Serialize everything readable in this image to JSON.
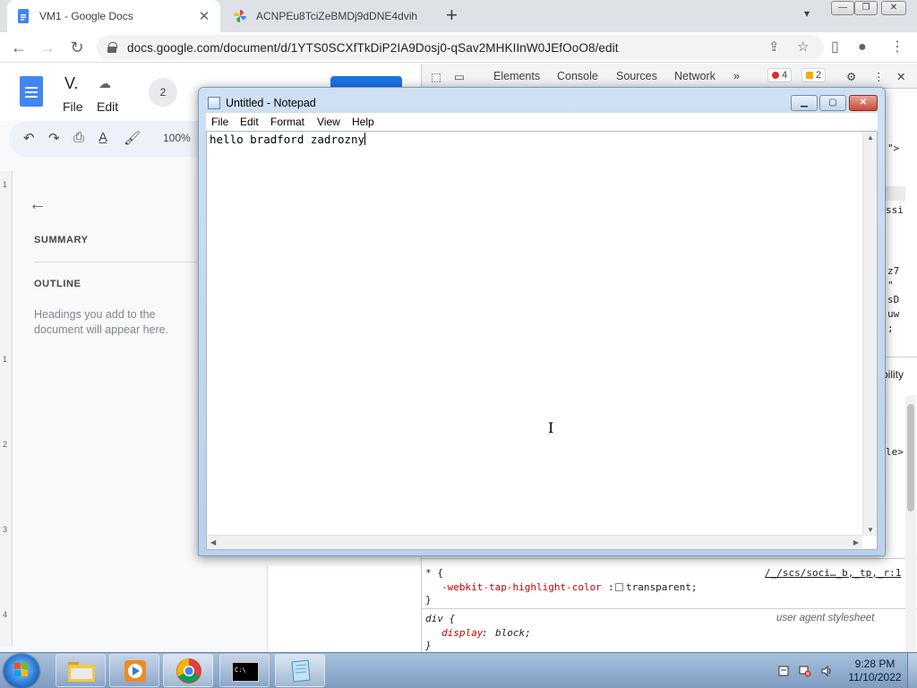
{
  "browser": {
    "tabs": [
      {
        "title": "VM1 - Google Docs",
        "close": "✕"
      },
      {
        "title": "ACNPEu8TciZeBMDj9dDNE4dvih"
      }
    ],
    "new_tab": "+",
    "url": "docs.google.com/document/d/1YTS0SCXfTkDiP2IA9Dosj0-qSav2MHKIInW0JEfOoO8/edit"
  },
  "docs": {
    "title": "V.",
    "menu": [
      "File",
      "Edit"
    ],
    "collaborators": "2",
    "zoom": "100%",
    "outline": {
      "summary": "SUMMARY",
      "outline": "OUTLINE",
      "hint": "Headings you add to the document will appear here."
    },
    "ruler": [
      "1",
      "1",
      "2",
      "3",
      "4"
    ]
  },
  "devtools": {
    "tabs": [
      "Elements",
      "Console",
      "Sources",
      "Network"
    ],
    "more": "»",
    "errors": "4",
    "warnings": "2",
    "side_fragments": [
      "\">",
      "ssi",
      "z7",
      "\"",
      "sD",
      "uw",
      ";",
      "bility",
      "le>"
    ],
    "styles": [
      {
        "selector": "* {",
        "source": "/_/scs/soci…_b,_tp,_r:1",
        "prop": "-webkit-tap-highlight-color",
        "value": "transparent;",
        "close": "}"
      },
      {
        "selector": "div {",
        "source": "user agent stylesheet",
        "prop": "display",
        "value": "block;",
        "close": "}"
      }
    ]
  },
  "notepad": {
    "title": "Untitled - Notepad",
    "menu": [
      "File",
      "Edit",
      "Format",
      "View",
      "Help"
    ],
    "content": "hello bradford zadrozny"
  },
  "taskbar": {
    "time": "9:28 PM",
    "date": "11/10/2022"
  },
  "colors": {
    "docs_blue": "#4285f4",
    "share_blue": "#1a73e8",
    "devtools_error": "#d93025",
    "devtools_warning": "#f9ab00"
  }
}
